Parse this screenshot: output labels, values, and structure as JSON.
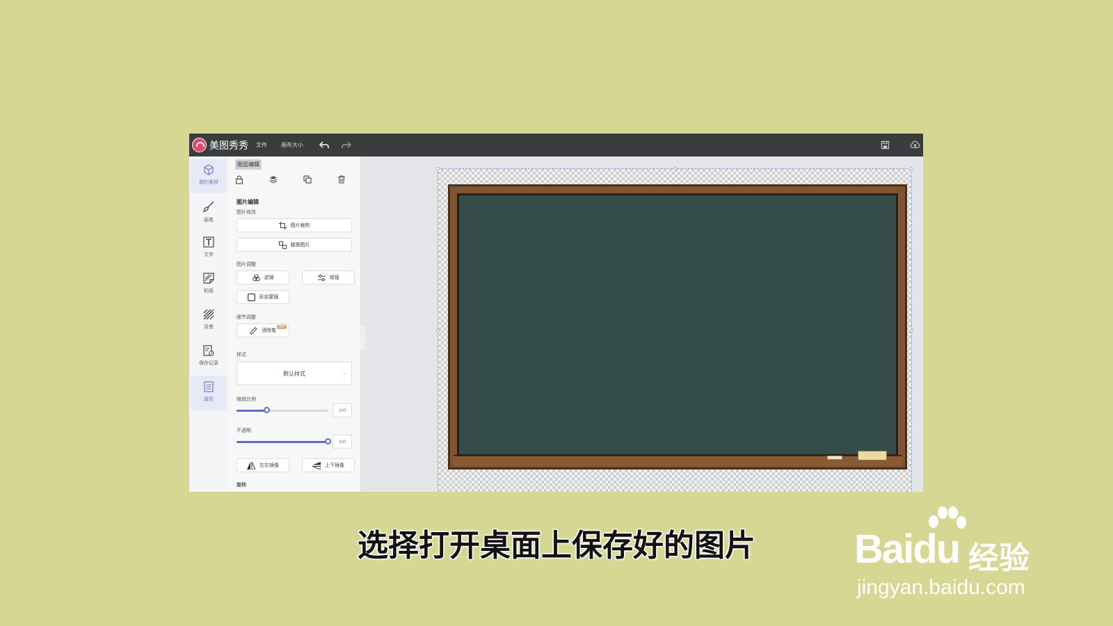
{
  "app": {
    "brand": "美图秀秀",
    "menu": [
      "文件",
      "画布大小"
    ],
    "topbar_icons": [
      "undo-icon",
      "redo-icon",
      "save-icon",
      "cloud-upload-icon"
    ]
  },
  "sidebar": {
    "items": [
      {
        "label": "我的素材",
        "icon": "cube-icon",
        "active": true
      },
      {
        "label": "画笔",
        "icon": "brush-icon"
      },
      {
        "label": "文字",
        "icon": "text-icon"
      },
      {
        "label": "贴纸",
        "icon": "sticker-icon"
      },
      {
        "label": "背景",
        "icon": "background-icon"
      },
      {
        "label": "保存记录",
        "icon": "history-icon"
      },
      {
        "label": "属性",
        "icon": "properties-icon"
      }
    ]
  },
  "panel": {
    "tooltip": "图层编辑",
    "tools": [
      "lock-icon",
      "layers-icon",
      "duplicate-icon",
      "delete-icon"
    ],
    "image_edit_title": "图片编辑",
    "image_modify_label": "图片修改",
    "crop_label": "图片裁剪",
    "replace_label": "替换图片",
    "adjust_label": "图片调整",
    "filter_label": "滤镜",
    "enhance_label": "增强",
    "shape_mask_label": "形状蒙版",
    "detail_label": "细节调整",
    "eraser_label": "消除笔",
    "vip_badge": "VIP",
    "style_label": "样式",
    "style_value": "默认样式",
    "scale_label": "缩放比例",
    "scale_value": "100",
    "scale_level": 0.33,
    "opacity_label": "不透明",
    "opacity_value": "100",
    "opacity_level": 1.0,
    "flip_h_label": "左右镜像",
    "flip_v_label": "上下镜像",
    "rotate_label": "旋转"
  },
  "subtitle": "选择打开桌面上保存好的图片",
  "watermark": {
    "brand": "Bai",
    "brand2": "du",
    "product": "经验",
    "url": "jingyan.baidu.com"
  },
  "colors": {
    "background": "#d6d792",
    "topbar": "#3b3c3e",
    "accent": "#5b70c4",
    "chalkboard": "#344c4a",
    "frame": "#7f5433"
  }
}
